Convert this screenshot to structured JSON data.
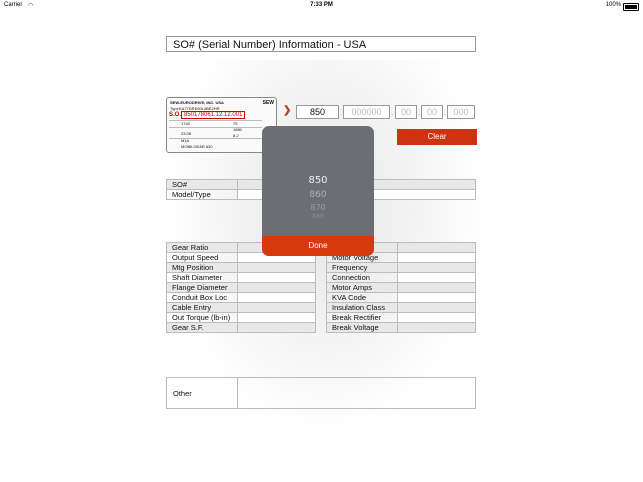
{
  "status_bar": {
    "carrier": "Carrier",
    "time": "7:33 PM",
    "battery": "100%"
  },
  "page_title": "SO# (Serial Number) Information - USA",
  "nameplate": {
    "company": "SEW-EURODRIVE, INC. USA",
    "type_label": "Type",
    "type_value": "KA77DRE90L4BE2HR",
    "so_label": "S.O.",
    "so_value": "850178061.12.12.001",
    "rpm": "1740",
    "hp": "75",
    "ratio": "23.08",
    "torque": "1680",
    "sf": "8.2",
    "mounting": "M1A",
    "lube": "MOBILGEAR 630",
    "logo": "SEW"
  },
  "so_inputs": {
    "field1": "850",
    "field2_placeholder": "000000",
    "field3_placeholder": "00",
    "field4_placeholder": "00",
    "field5_placeholder": "000"
  },
  "clear_label": "Clear",
  "info_table": {
    "rows": [
      {
        "label": "SO#",
        "value": ""
      },
      {
        "label": "Model/Type",
        "value": ""
      }
    ]
  },
  "left_specs": [
    "Gear Ratio",
    "Output Speed",
    "Mtg Position",
    "Shaft Diameter",
    "Flange Diameter",
    "Conduit Box Loc",
    "Cable Entry",
    "Out Torque (lb-in)",
    "Gear S.F."
  ],
  "right_specs": [
    "",
    "Motor Voltage",
    "Frequency",
    "Connection",
    "Motor Amps",
    "KVA Code",
    "Insulation Class",
    "Break Rectifier",
    "Break Voltage"
  ],
  "other_label": "Other",
  "picker": {
    "options": [
      "850",
      "860",
      "870",
      "880"
    ],
    "done_label": "Done"
  },
  "colors": {
    "accent": "#cc3311",
    "picker_bg": "#6b6e73",
    "done_bg": "#d8380e"
  }
}
